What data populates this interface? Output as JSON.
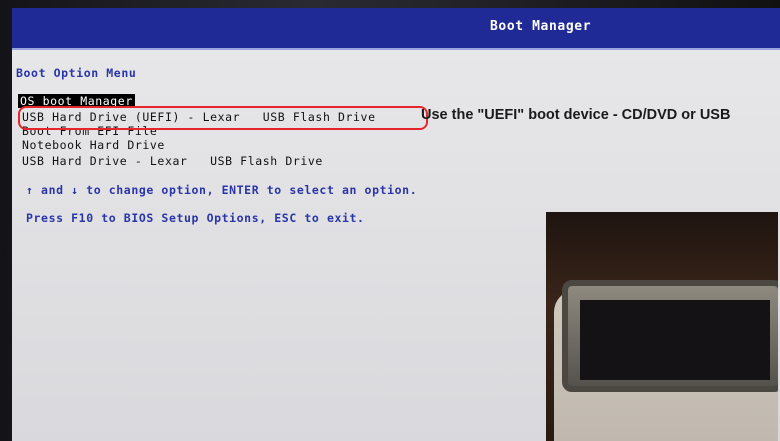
{
  "header": {
    "title": "Boot Manager"
  },
  "menu": {
    "heading": "Boot Option Menu",
    "items": [
      {
        "label": "OS boot Manager",
        "selected": true
      },
      {
        "label": "USB Hard Drive (UEFI) - Lexar   USB Flash Drive",
        "selected": false
      },
      {
        "label": "Boot From EFI File",
        "selected": false
      },
      {
        "label": "Notebook Hard Drive",
        "selected": false
      },
      {
        "label": "USB Hard Drive - Lexar   USB Flash Drive",
        "selected": false
      }
    ]
  },
  "annotation": {
    "text": "Use the \"UEFI\" boot device - CD/DVD or USB",
    "highlight_color": "#e5262c"
  },
  "help": {
    "navigate": "↑ and ↓ to change option, ENTER to select an option.",
    "exit": "Press F10 to BIOS Setup Options, ESC to exit."
  },
  "colors": {
    "titlebar": "#1f2a96",
    "text_blue": "#2a35a8",
    "screen_bg": "#e2e2e5"
  }
}
